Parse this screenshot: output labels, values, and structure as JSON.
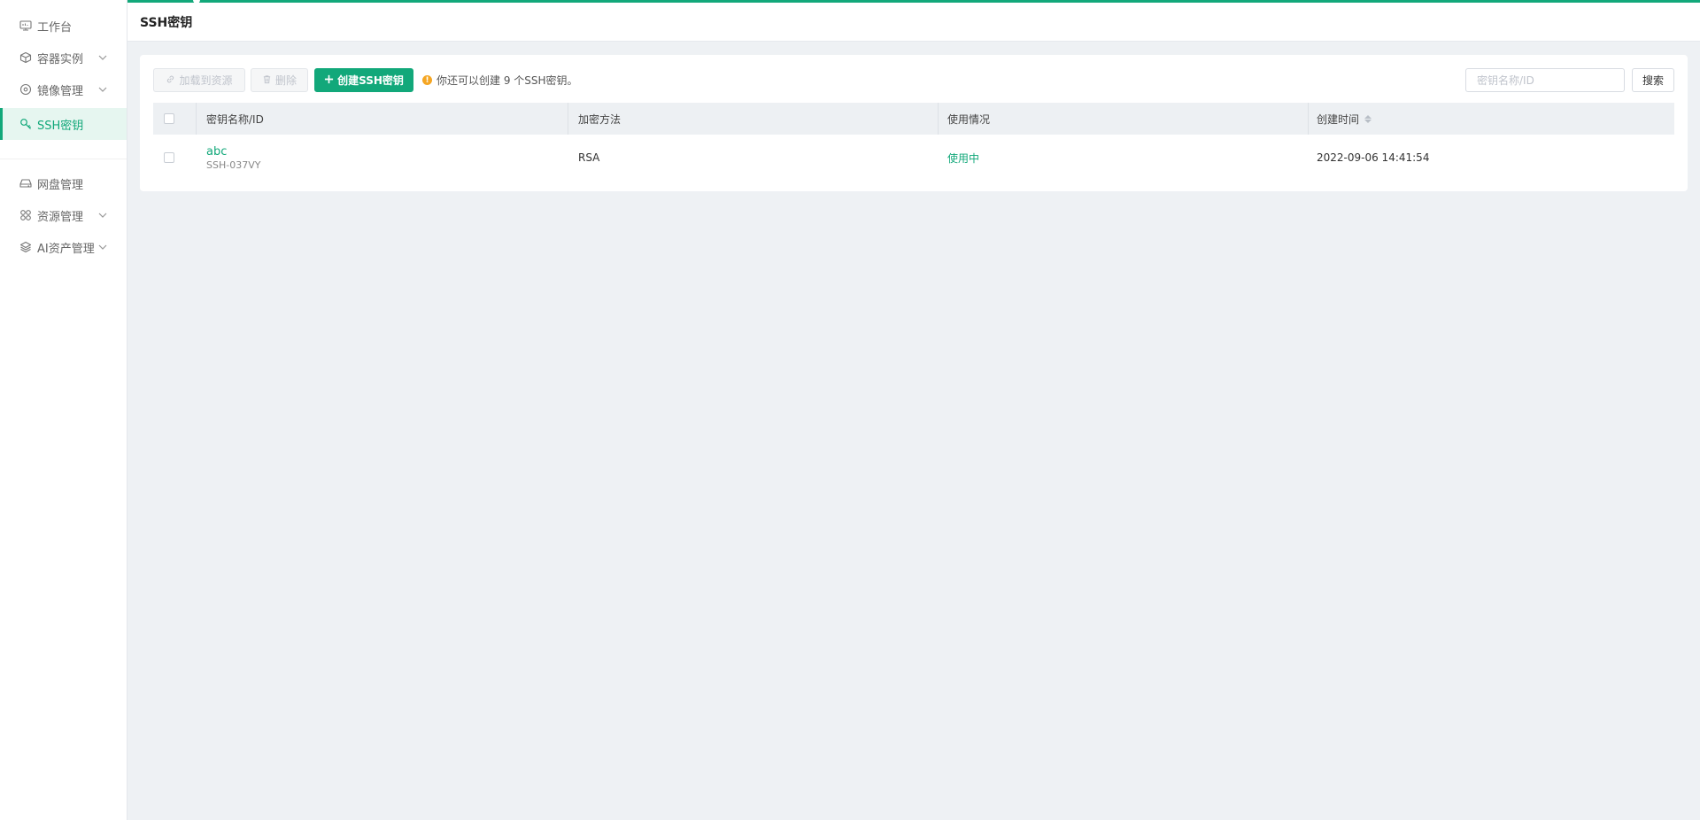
{
  "sidebar": {
    "items": [
      {
        "label": "工作台",
        "icon": "monitor-icon",
        "has_children": false
      },
      {
        "label": "容器实例",
        "icon": "cube-icon",
        "has_children": true
      },
      {
        "label": "镜像管理",
        "icon": "disc-icon",
        "has_children": true
      },
      {
        "label": "SSH密钥",
        "icon": "key-icon",
        "has_children": false,
        "active": true
      },
      {
        "label": "网盘管理",
        "icon": "drive-icon",
        "has_children": false
      },
      {
        "label": "资源管理",
        "icon": "grid-icon",
        "has_children": true
      },
      {
        "label": "AI资产管理",
        "icon": "layers-icon",
        "has_children": true
      }
    ]
  },
  "header": {
    "title": "SSH密钥"
  },
  "toolbar": {
    "attach_label": "加载到资源",
    "delete_label": "删除",
    "create_label": "创建SSH密钥",
    "tip": "你还可以创建 9 个SSH密钥。",
    "search_placeholder": "密钥名称/ID",
    "search_label": "搜索"
  },
  "table": {
    "columns": [
      "密钥名称/ID",
      "加密方法",
      "使用情况",
      "创建时间"
    ],
    "rows": [
      {
        "name": "abc",
        "id": "SSH-037VY",
        "method": "RSA",
        "usage": "使用中",
        "created": "2022-09-06 14:41:54"
      }
    ]
  },
  "colors": {
    "accent": "#12a87a",
    "warning": "#f5a623",
    "background": "#eef1f4"
  }
}
